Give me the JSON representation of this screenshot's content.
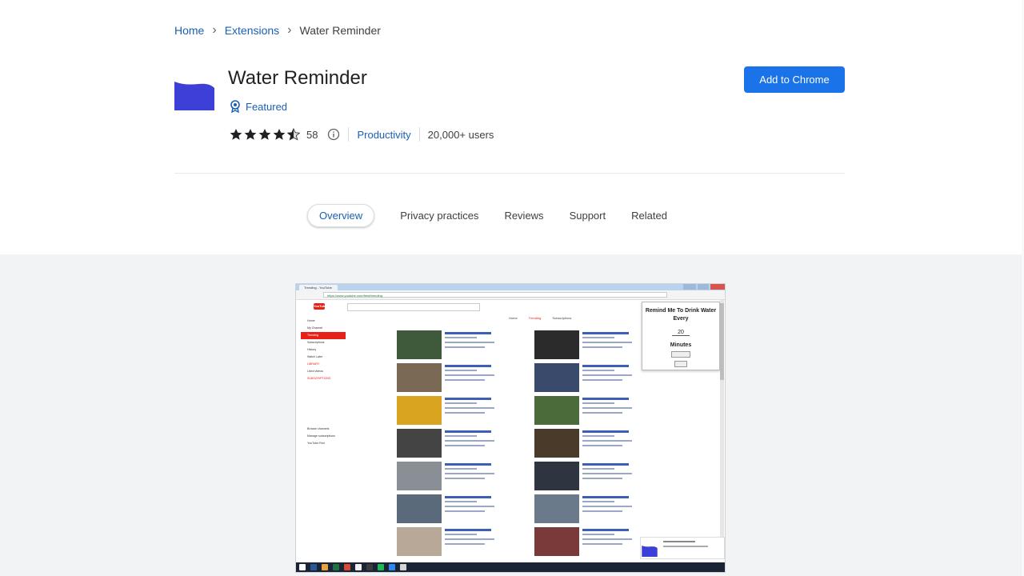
{
  "breadcrumb": {
    "home": "Home",
    "extensions": "Extensions",
    "current": "Water Reminder"
  },
  "extension": {
    "title": "Water Reminder",
    "featured_label": "Featured",
    "rating": 4.5,
    "rating_count": "58",
    "category": "Productivity",
    "users": "20,000+ users",
    "logo_color": "#3d40d6"
  },
  "actions": {
    "add_label": "Add to Chrome"
  },
  "tabs": [
    {
      "label": "Overview",
      "active": true
    },
    {
      "label": "Privacy practices",
      "active": false
    },
    {
      "label": "Reviews",
      "active": false
    },
    {
      "label": "Support",
      "active": false
    },
    {
      "label": "Related",
      "active": false
    }
  ],
  "screenshot": {
    "browser_tab": "Trending - YouTube",
    "address": "https://www.youtube.com/feed/trending",
    "yt_logo": "YouTube",
    "yt_nav": [
      "Home",
      "Trending",
      "Subscriptions"
    ],
    "yt_sidebar": [
      "Home",
      "My Channel",
      "Trending",
      "Subscriptions",
      "History",
      "Watch Later",
      "LIBRARY",
      "Liked videos",
      "SUBSCRIPTIONS",
      "Browse channels",
      "Manage subscriptions",
      "YouTube Red"
    ],
    "popup": {
      "title": "Remind Me To Drink Water Every",
      "value": "20",
      "unit": "Minutes"
    }
  }
}
